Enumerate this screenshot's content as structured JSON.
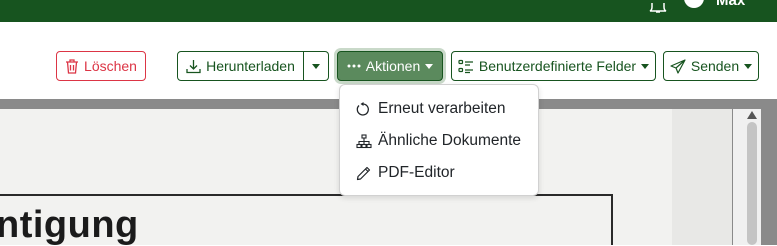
{
  "topbar": {
    "username": "Max",
    "icons": [
      "bell-icon",
      "user-avatar-icon"
    ]
  },
  "toolbar": {
    "delete_label": "Löschen",
    "download_label": "Herunterladen",
    "actions_label": "Aktionen",
    "custom_fields_label": "Benutzerdefinierte Felder",
    "send_label": "Senden"
  },
  "actions_menu": {
    "items": [
      {
        "label": "Erneut verarbeiten",
        "icon": "refresh-icon"
      },
      {
        "label": "Ähnliche Dokumente",
        "icon": "diagram-icon"
      },
      {
        "label": "PDF-Editor",
        "icon": "pencil-icon"
      }
    ]
  },
  "document": {
    "visible_text": "ntigung"
  },
  "colors": {
    "brand": "#17541f",
    "danger": "#dc3545",
    "active_button": "#5b8a5d"
  }
}
